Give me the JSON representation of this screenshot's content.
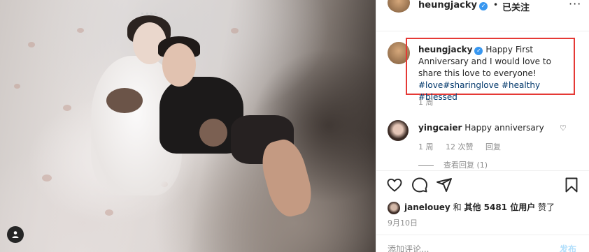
{
  "post": {
    "username": "heungjacky",
    "follow_label": "已关注",
    "separator": "•",
    "more_label": "···"
  },
  "caption": {
    "username": "heungjacky",
    "text": "Happy First Anniversary and I would love to share this love to everyone!",
    "hashtags": "#love#sharinglove #healthy #blessed",
    "time": "1 周"
  },
  "comment": {
    "username": "yingcaier",
    "text": "Happy anniversary",
    "time": "1 周",
    "likes": "12 次赞",
    "reply_label": "回复",
    "view_replies": "查看回复 (1)"
  },
  "likes": {
    "username": "janelouey",
    "conjunction": "和",
    "others": "其他 5481 位用户",
    "suffix": "赞了"
  },
  "date": "9月10日",
  "add_comment": {
    "placeholder": "添加评论...",
    "post_label": "发布"
  },
  "colors": {
    "highlight_box": "#e53935",
    "link": "#00376b",
    "verified": "#3897f0",
    "muted": "#8e8e8e"
  },
  "icons": [
    "heart-icon",
    "comment-icon",
    "share-icon",
    "bookmark-icon",
    "verified-badge-icon",
    "user-tag-icon",
    "more-icon",
    "like-comment-icon"
  ]
}
